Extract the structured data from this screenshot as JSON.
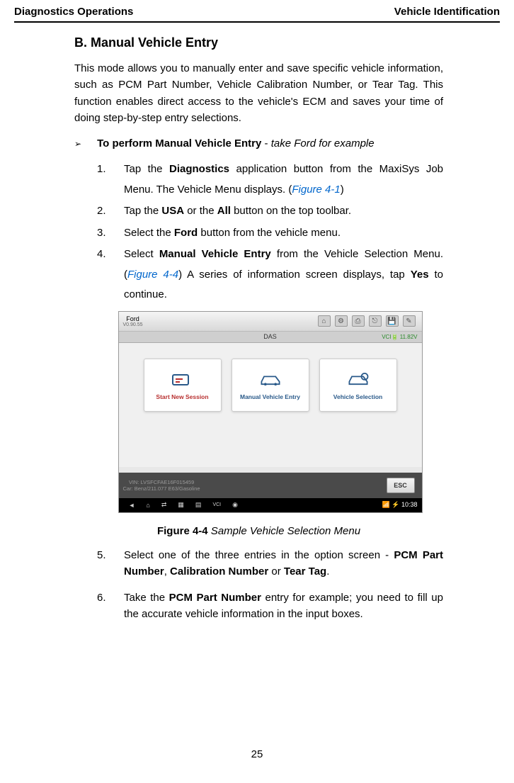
{
  "header": {
    "left": "Diagnostics Operations",
    "right": "Vehicle Identification"
  },
  "section": {
    "title": "B.   Manual Vehicle Entry",
    "intro": "This mode allows you to manually enter and save specific vehicle information, such as PCM Part Number, Vehicle Calibration Number, or Tear Tag. This function enables direct access to the vehicle's ECM and saves your time of doing step-by-step entry selections."
  },
  "task": {
    "bold": "To perform Manual Vehicle Entry",
    "sep": " - ",
    "italic": "take Ford for example"
  },
  "steps": {
    "s1a": "Tap the ",
    "s1b": "Diagnostics",
    "s1c": " application button from the MaxiSys Job Menu. The Vehicle Menu displays. (",
    "s1fig": "Figure 4-1",
    "s1d": ")",
    "s2a": "Tap the ",
    "s2b": "USA",
    "s2c": " or the ",
    "s2d": "All",
    "s2e": " button on the top toolbar.",
    "s3a": "Select the ",
    "s3b": "Ford",
    "s3c": " button from the vehicle menu.",
    "s4a": "Select ",
    "s4b": "Manual Vehicle Entry",
    "s4c": " from the Vehicle Selection Menu. (",
    "s4fig": "Figure 4-4",
    "s4d": ") A series of information screen displays, tap ",
    "s4e": "Yes",
    "s4f": " to continue.",
    "s5a": "Select one of the three entries in the option screen - ",
    "s5b": "PCM Part Number",
    "s5c": ", ",
    "s5d": "Calibration Number",
    "s5e": " or ",
    "s5f": "Tear Tag",
    "s5g": ".",
    "s6a": "Take the ",
    "s6b": "PCM Part Number",
    "s6c": " entry for example; you need to fill up the accurate vehicle information in the input boxes."
  },
  "screenshot": {
    "ford_label": "Ford",
    "ford_ver": "V0.90.55",
    "das": "DAS",
    "voltage": "11.82V",
    "card1": "Start New Session",
    "card2": "Manual Vehicle Entry",
    "card3": "Vehicle Selection",
    "vin": "VIN: LVSFCFAE16F015459",
    "car": "Car: Benz/211.077 E63/Gasoline",
    "esc": "ESC",
    "home_icon": "⌂",
    "setting_icon": "⚙",
    "print_icon": "⎙",
    "disk_icon": "💾",
    "pen_icon": "✎",
    "back_icon": "◄",
    "home2_icon": "⌂",
    "swap_icon": "⇄",
    "car_icon": "🚗",
    "vci_icon": "VCI",
    "cam_icon": "📷",
    "time": "10:38"
  },
  "figure_caption": {
    "num": "Figure 4-4",
    "text": " Sample Vehicle Selection Menu"
  },
  "page_num": "25",
  "nums": {
    "n1": "1.",
    "n2": "2.",
    "n3": "3.",
    "n4": "4.",
    "n5": "5.",
    "n6": "6."
  }
}
